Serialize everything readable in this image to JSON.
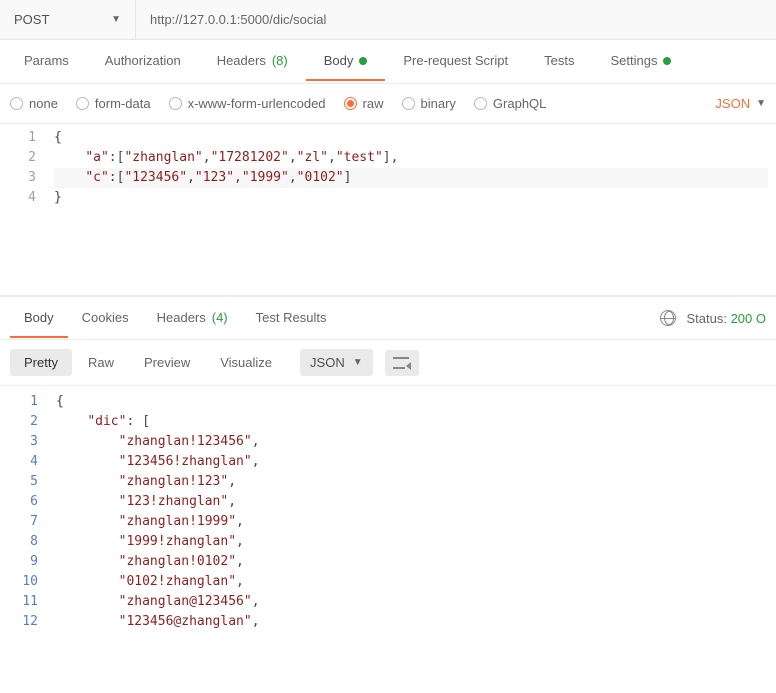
{
  "topbar": {
    "method": "POST",
    "url": "http://127.0.0.1:5000/dic/social"
  },
  "tabs": {
    "params": "Params",
    "authorization": "Authorization",
    "headers": "Headers",
    "headers_count": "(8)",
    "body": "Body",
    "pre_request": "Pre-request Script",
    "tests": "Tests",
    "settings": "Settings"
  },
  "body_types": {
    "none": "none",
    "form_data": "form-data",
    "x_www": "x-www-form-urlencoded",
    "raw": "raw",
    "binary": "binary",
    "graphql": "GraphQL",
    "type_select": "JSON"
  },
  "request_body": {
    "lines": [
      "1",
      "2",
      "3",
      "4"
    ],
    "l1": "{",
    "l2_key": "\"a\"",
    "l2_vals": [
      "\"zhanglan\"",
      "\"17281202\"",
      "\"zl\"",
      "\"test\""
    ],
    "l3_key": "\"c\"",
    "l3_vals": [
      "\"123456\"",
      "\"123\"",
      "\"1999\"",
      "\"0102\""
    ],
    "l4": "}"
  },
  "resp_tabs": {
    "body": "Body",
    "cookies": "Cookies",
    "headers": "Headers",
    "headers_count": "(4)",
    "test_results": "Test Results"
  },
  "resp_status": {
    "label": "Status:",
    "value": "200 O"
  },
  "resp_tools": {
    "pretty": "Pretty",
    "raw": "Raw",
    "preview": "Preview",
    "visualize": "Visualize",
    "format": "JSON"
  },
  "response_body": {
    "lines": [
      "1",
      "2",
      "3",
      "4",
      "5",
      "6",
      "7",
      "8",
      "9",
      "10",
      "11",
      "12"
    ],
    "dic_key": "\"dic\"",
    "items": [
      "\"zhanglan!123456\"",
      "\"123456!zhanglan\"",
      "\"zhanglan!123\"",
      "\"123!zhanglan\"",
      "\"zhanglan!1999\"",
      "\"1999!zhanglan\"",
      "\"zhanglan!0102\"",
      "\"0102!zhanglan\"",
      "\"zhanglan@123456\"",
      "\"123456@zhanglan\""
    ]
  },
  "chart_data": {
    "type": "table",
    "note": "not a chart"
  }
}
